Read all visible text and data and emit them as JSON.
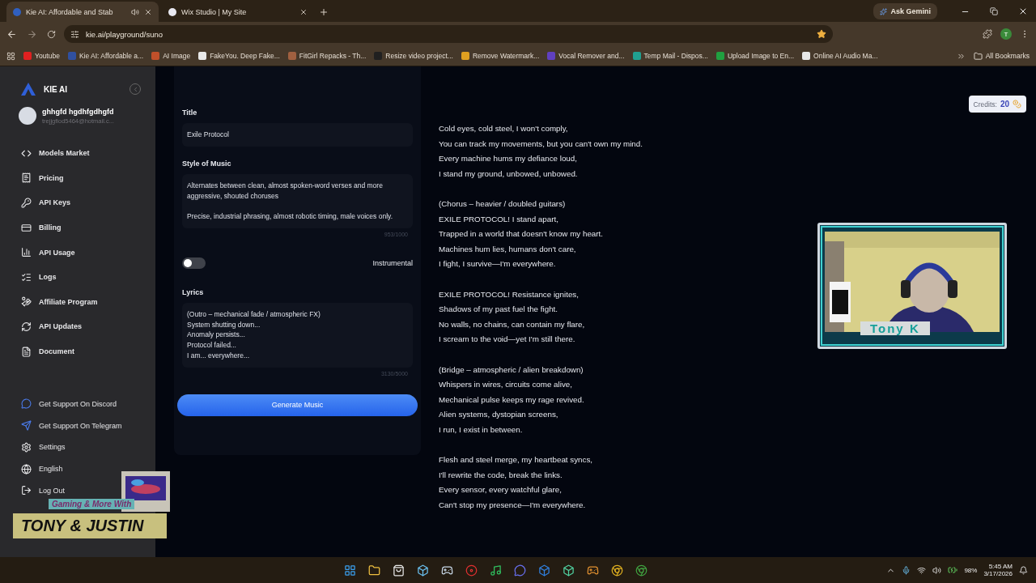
{
  "browser": {
    "tabs": [
      {
        "title": "Kie AI: Affordable and Stab",
        "selected": true,
        "audio": true
      },
      {
        "title": "Wix Studio | My Site",
        "selected": false,
        "audio": false
      }
    ],
    "url": "kie.ai/playground/suno",
    "ask": "Ask Gemini",
    "profile_initial": "T",
    "bookmarks": [
      "Youtube",
      "Kie AI: Affordable a...",
      "AI Image",
      "FakeYou. Deep Fake...",
      "FitGirl Repacks - Th...",
      "Resize video project...",
      "Remove Watermark...",
      "Vocal Remover and...",
      "Temp Mail - Dispos...",
      "Upload Image to En...",
      "Online AI Audio Ma..."
    ],
    "all_bookmarks": "All Bookmarks"
  },
  "sidebar": {
    "brand": "KIE AI",
    "user": {
      "name": "ghhgfd hgdhfgdhgfd",
      "email": "trejjgfiod5464@hotmail.c..."
    },
    "nav": [
      "Models Market",
      "Pricing",
      "API Keys",
      "Billing",
      "API Usage",
      "Logs",
      "Affiliate Program",
      "API Updates",
      "Document"
    ],
    "support": [
      "Get Support On Discord",
      "Get Support On Telegram",
      "Settings",
      "English",
      "Log Out"
    ]
  },
  "form": {
    "title_label": "Title",
    "title_value": "Exile Protocol",
    "style_label": "Style of Music",
    "style_value": "Alternates between clean, almost spoken-word verses and more aggressive, shouted choruses\n\nPrecise, industrial phrasing, almost robotic timing, male voices only.",
    "style_count": "953/1000",
    "instrumental": {
      "label": "Instrumental",
      "on": false
    },
    "lyrics_label": "Lyrics",
    "lyrics_value": "(Outro – mechanical fade / atmospheric FX)\nSystem shutting down...\nAnomaly persists...\nProtocol failed...\nI am... everywhere...",
    "lyrics_count": "3130/5000",
    "generate": "Generate Music"
  },
  "lyrics": [
    [
      "Cold eyes, cold steel, I won't comply,",
      "You can track my movements, but you can't own my mind.",
      "Every machine hums my defiance loud,",
      "I stand my ground, unbowed, unbowed."
    ],
    [
      "(Chorus – heavier / doubled guitars)",
      "EXILE PROTOCOL! I stand apart,",
      "Trapped in a world that doesn't know my heart.",
      "Machines hum lies, humans don't care,",
      "I fight, I survive—I'm everywhere."
    ],
    [
      "EXILE PROTOCOL! Resistance ignites,",
      "Shadows of my past fuel the fight.",
      "No walls, no chains, can contain my flare,",
      "I scream to the void—yet I'm still there."
    ],
    [
      "(Bridge – atmospheric / alien breakdown)",
      "Whispers in wires, circuits come alive,",
      "Mechanical pulse keeps my rage revived.",
      "Alien systems, dystopian screens,",
      "I run, I exist in between."
    ],
    [
      "Flesh and steel merge, my heartbeat syncs,",
      "I'll rewrite the code, break the links.",
      "Every sensor, every watchful glare,",
      "Can't stop my presence—I'm everywhere."
    ]
  ],
  "credits": {
    "label": "Credits:",
    "value": "20"
  },
  "webcam": {
    "kind": "picture",
    "name": "Tony K"
  },
  "stream_overlay": {
    "tagline": "Gaming & More With",
    "title": "TONY & JUSTIN"
  },
  "taskbar": {
    "battery": "98%",
    "time": "5:45 AM",
    "date": "3/17/2026"
  }
}
